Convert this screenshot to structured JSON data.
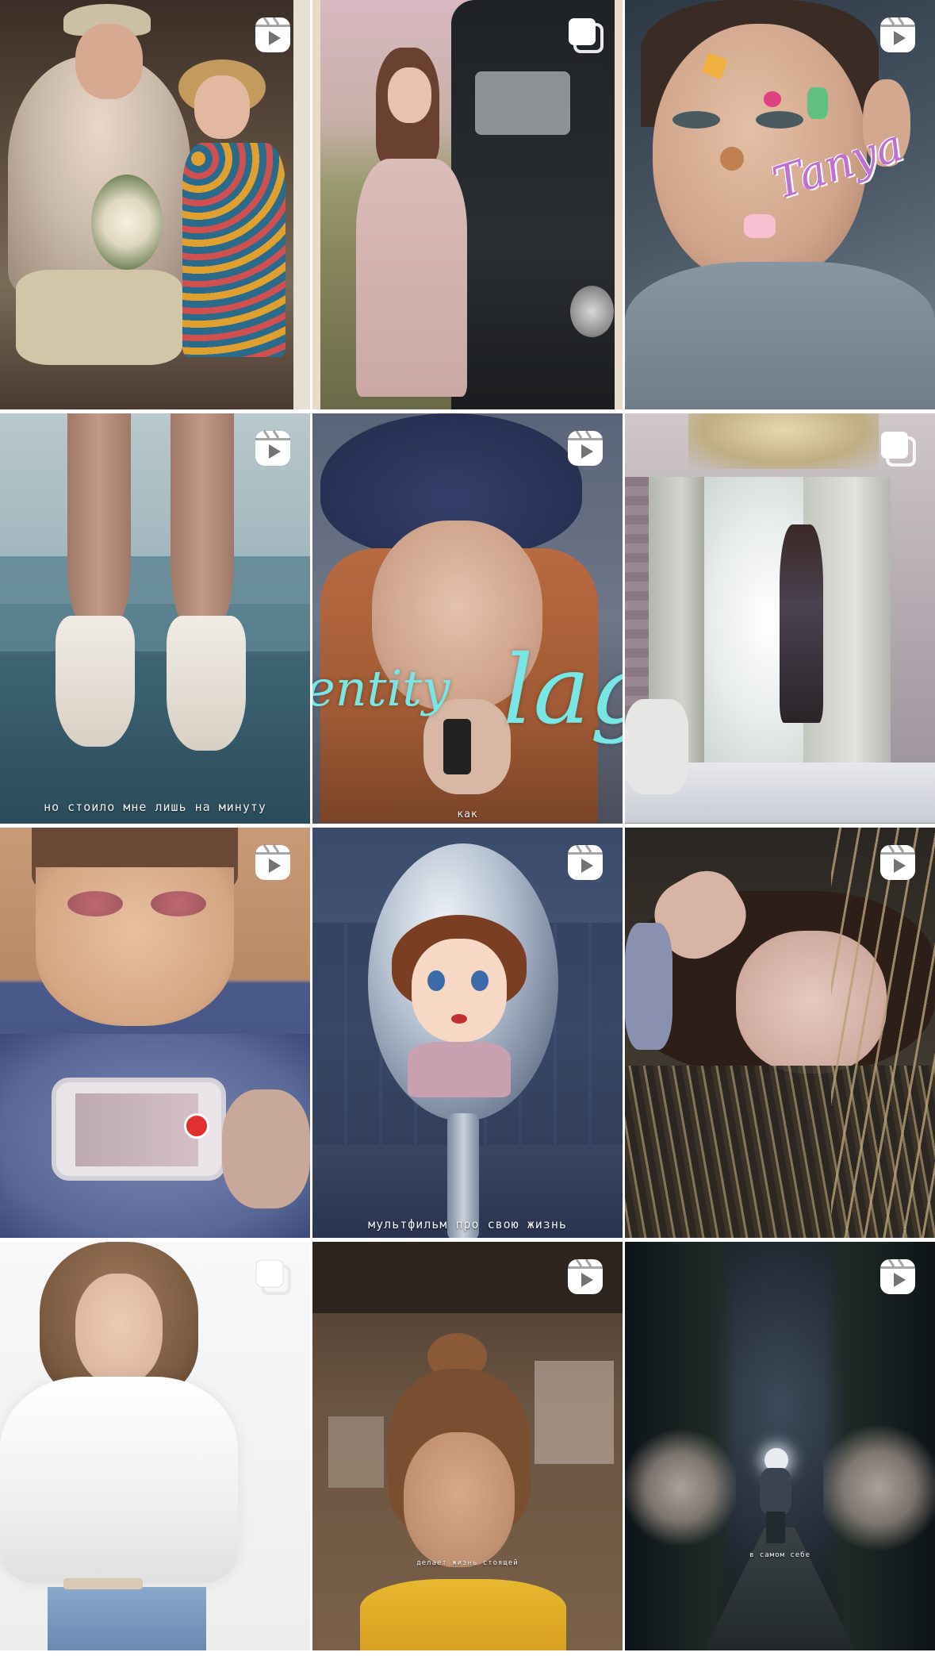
{
  "tiles": [
    {
      "type": "reel",
      "type_icon": "reels-icon",
      "caption": "",
      "overlay": ""
    },
    {
      "type": "carousel",
      "type_icon": "carousel-icon",
      "caption": "",
      "overlay": ""
    },
    {
      "type": "reel",
      "type_icon": "reels-icon",
      "caption": "",
      "overlay": "Tanya"
    },
    {
      "type": "reel",
      "type_icon": "reels-icon",
      "caption": "но стоило мне лишь на минуту",
      "overlay": ""
    },
    {
      "type": "reel",
      "type_icon": "reels-icon",
      "caption": "как",
      "overlay_left": "entity",
      "overlay_right": "lag"
    },
    {
      "type": "carousel",
      "type_icon": "carousel-icon",
      "caption": "",
      "overlay": ""
    },
    {
      "type": "reel",
      "type_icon": "reels-icon",
      "caption": "",
      "overlay": ""
    },
    {
      "type": "reel",
      "type_icon": "reels-icon",
      "caption": "мультфильм про свою жизнь",
      "overlay": ""
    },
    {
      "type": "reel",
      "type_icon": "reels-icon",
      "caption": "",
      "overlay": ""
    },
    {
      "type": "carousel",
      "type_icon": "carousel-icon",
      "caption": "",
      "overlay": ""
    },
    {
      "type": "reel",
      "type_icon": "reels-icon",
      "caption": "делает жизнь стоящей",
      "overlay": ""
    },
    {
      "type": "reel",
      "type_icon": "reels-icon",
      "caption": "в самом себе",
      "overlay": ""
    }
  ]
}
